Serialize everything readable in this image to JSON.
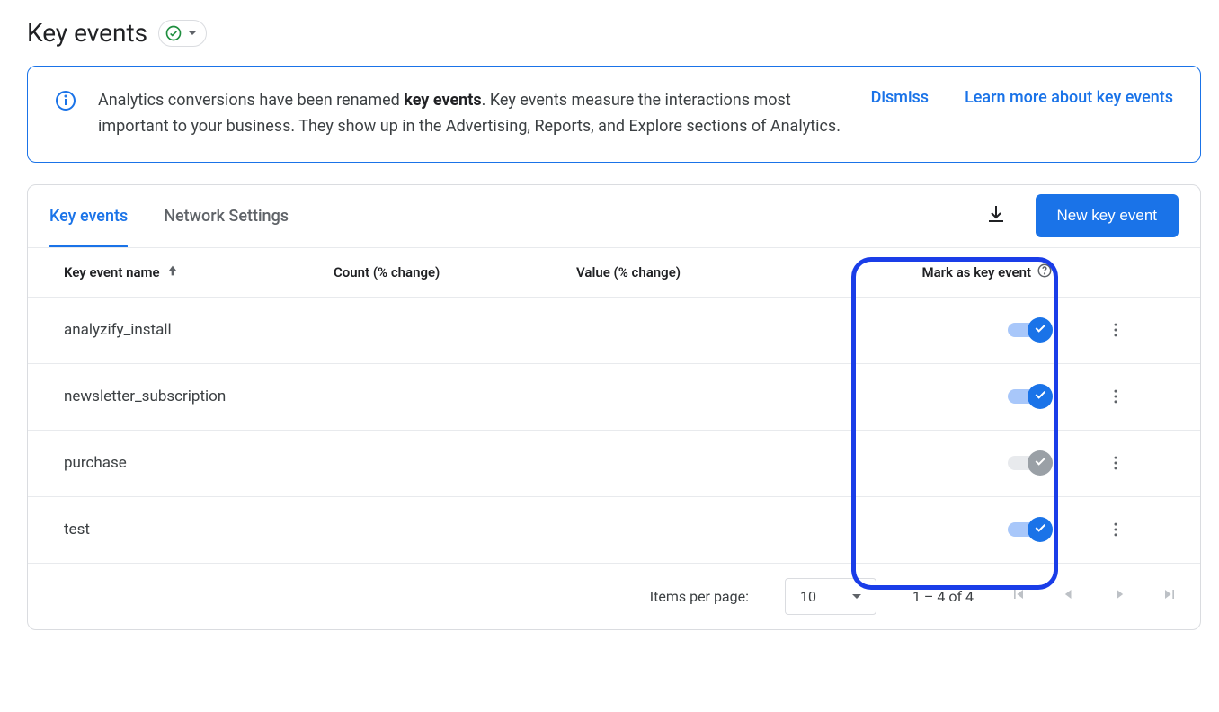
{
  "header": {
    "title": "Key events"
  },
  "banner": {
    "text_pre": "Analytics conversions have been renamed ",
    "text_bold": "key events",
    "text_post": ". Key events measure the interactions most important to your business. They show up in the Advertising, Reports, and Explore sections of Analytics.",
    "dismiss": "Dismiss",
    "learn_more": "Learn more about key events"
  },
  "tabs": {
    "key_events": "Key events",
    "network_settings": "Network Settings"
  },
  "actions": {
    "new_key_event": "New key event"
  },
  "columns": {
    "name": "Key event name",
    "count": "Count (% change)",
    "value": "Value (% change)",
    "mark": "Mark as key event"
  },
  "rows": [
    {
      "name": "analyzify_install",
      "on": true,
      "disabled": false
    },
    {
      "name": "newsletter_subscription",
      "on": true,
      "disabled": false
    },
    {
      "name": "purchase",
      "on": true,
      "disabled": true
    },
    {
      "name": "test",
      "on": true,
      "disabled": false
    }
  ],
  "paginator": {
    "items_per_page_label": "Items per page:",
    "page_size": "10",
    "range": "1 – 4 of 4"
  }
}
